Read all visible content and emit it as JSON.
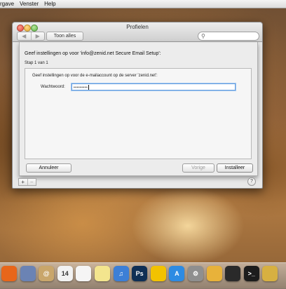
{
  "menubar": {
    "items": [
      "rgave",
      "Venster",
      "Help"
    ]
  },
  "window": {
    "title": "Profielen",
    "nav_back": "◀",
    "nav_forward": "▶",
    "show_all_label": "Toon alles",
    "search_placeholder": "",
    "search_icon": "magnifier-icon"
  },
  "sheet": {
    "heading": "Geef instellingen op voor 'info@zenid.net Secure Email Setup':",
    "step": "Stap 1 van 1",
    "description": "Geef instellingen op voor de e-mailaccount op de server 'zenid.net':",
    "password_label": "Wachtwoord:",
    "password_value": "•••••••••",
    "cancel_label": "Annuleer",
    "previous_label": "Vorige",
    "install_label": "Installeer"
  },
  "window_footer": {
    "add_label": "+",
    "remove_label": "−",
    "help_label": "?"
  },
  "dock": {
    "items": [
      {
        "name": "firefox-icon",
        "glyph": "",
        "color": "#e8661a"
      },
      {
        "name": "finder-preview-icon",
        "glyph": "",
        "color": "#6b83b4"
      },
      {
        "name": "address-book-icon",
        "glyph": "@",
        "color": "#c9a66b"
      },
      {
        "name": "calendar-icon",
        "glyph": "14",
        "color": "#f2f2f2"
      },
      {
        "name": "reminders-icon",
        "glyph": "",
        "color": "#f5f5f5"
      },
      {
        "name": "notes-icon",
        "glyph": "",
        "color": "#f3e58e"
      },
      {
        "name": "itunes-icon",
        "glyph": "♫",
        "color": "#3d7fd6"
      },
      {
        "name": "photoshop-icon",
        "glyph": "Ps",
        "color": "#0f2f55"
      },
      {
        "name": "cyberduck-icon",
        "glyph": "",
        "color": "#f2c200"
      },
      {
        "name": "app-store-icon",
        "glyph": "A",
        "color": "#2d8be3"
      },
      {
        "name": "system-preferences-icon",
        "glyph": "⚙",
        "color": "#8f8f8f"
      },
      {
        "name": "textwrangler-icon",
        "glyph": "",
        "color": "#e8b23a"
      },
      {
        "name": "toolbox-icon",
        "glyph": "",
        "color": "#2a2a2a"
      },
      {
        "name": "terminal-icon",
        "glyph": ">_",
        "color": "#1c1c1c"
      },
      {
        "name": "console-icon",
        "glyph": "",
        "color": "#d7b041"
      }
    ]
  }
}
